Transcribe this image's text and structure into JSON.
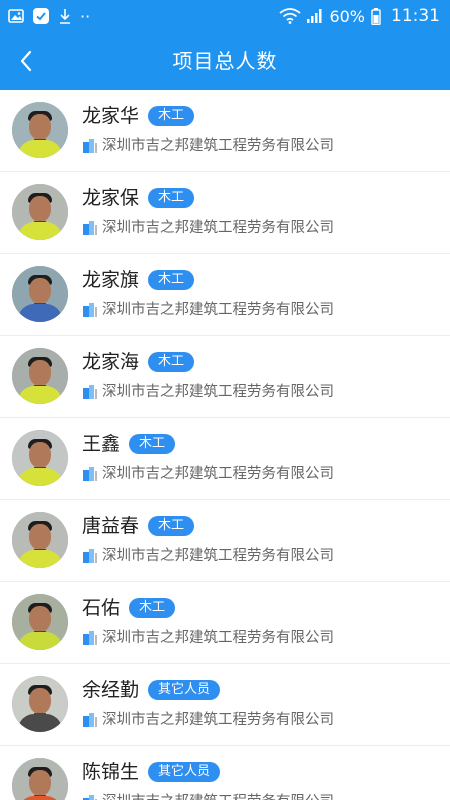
{
  "status_bar": {
    "battery_percent": "60%",
    "time": "11:31",
    "notification_dots": "··"
  },
  "header": {
    "title": "项目总人数",
    "back_icon": "chevron-left-icon"
  },
  "colors": {
    "primary": "#1f93f0",
    "badge": "#2f8ff0",
    "vest": "#d6e23a"
  },
  "workers": [
    {
      "name": "龙家华",
      "role": "木工",
      "company": "深圳市吉之邦建筑工程劳务有限公司"
    },
    {
      "name": "龙家保",
      "role": "木工",
      "company": "深圳市吉之邦建筑工程劳务有限公司"
    },
    {
      "name": "龙家旗",
      "role": "木工",
      "company": "深圳市吉之邦建筑工程劳务有限公司"
    },
    {
      "name": "龙家海",
      "role": "木工",
      "company": "深圳市吉之邦建筑工程劳务有限公司"
    },
    {
      "name": "王鑫",
      "role": "木工",
      "company": "深圳市吉之邦建筑工程劳务有限公司"
    },
    {
      "name": "唐益春",
      "role": "木工",
      "company": "深圳市吉之邦建筑工程劳务有限公司"
    },
    {
      "name": "石佑",
      "role": "木工",
      "company": "深圳市吉之邦建筑工程劳务有限公司"
    },
    {
      "name": "余经勤",
      "role": "其它人员",
      "company": "深圳市吉之邦建筑工程劳务有限公司"
    },
    {
      "name": "陈锦生",
      "role": "其它人员",
      "company": "深圳市吉之邦建筑工程劳务有限公司"
    }
  ]
}
